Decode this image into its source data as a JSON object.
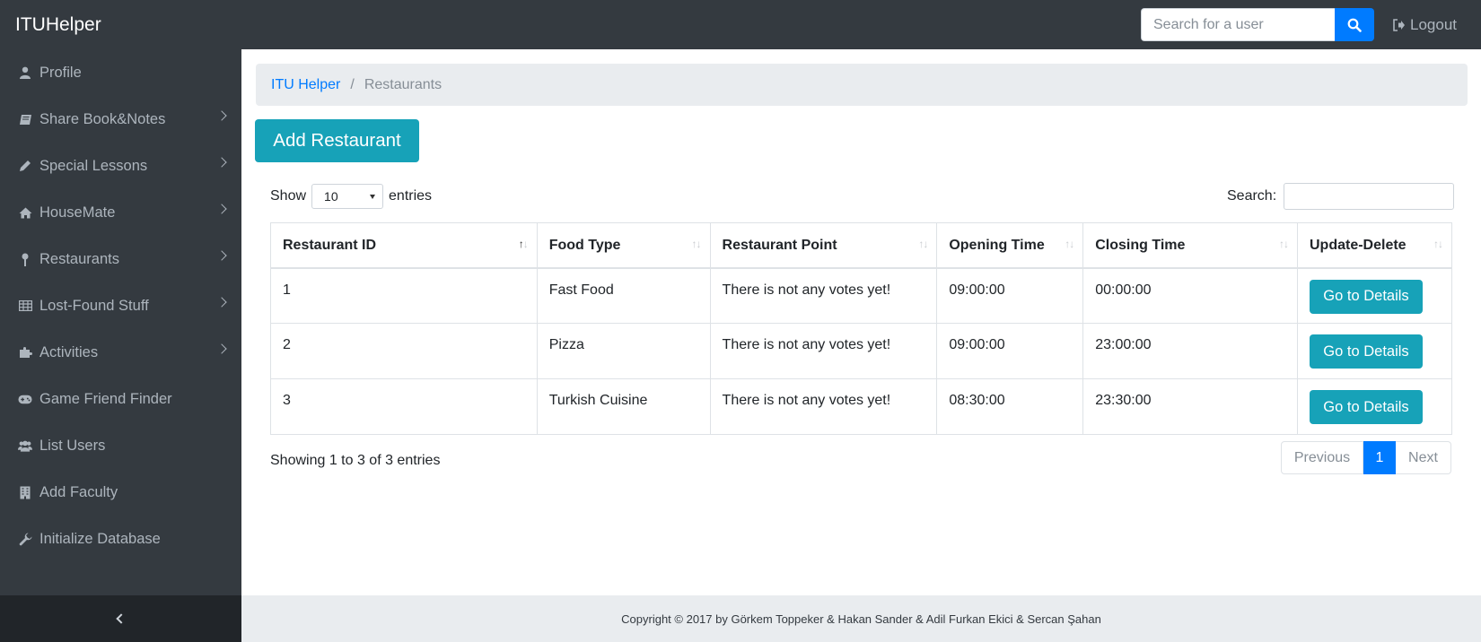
{
  "navbar": {
    "brand": "ITUHelper",
    "search_placeholder": "Search for a user",
    "logout_label": "Logout"
  },
  "sidebar": {
    "items": [
      {
        "label": "Profile",
        "icon": "user-icon",
        "has_submenu": false
      },
      {
        "label": "Share Book&Notes",
        "icon": "book-icon",
        "has_submenu": true
      },
      {
        "label": "Special Lessons",
        "icon": "pencil-icon",
        "has_submenu": true
      },
      {
        "label": "HouseMate",
        "icon": "home-icon",
        "has_submenu": true
      },
      {
        "label": "Restaurants",
        "icon": "pin-icon",
        "has_submenu": true
      },
      {
        "label": "Lost-Found Stuff",
        "icon": "table-icon",
        "has_submenu": true
      },
      {
        "label": "Activities",
        "icon": "puzzle-icon",
        "has_submenu": true
      },
      {
        "label": "Game Friend Finder",
        "icon": "gamepad-icon",
        "has_submenu": false
      },
      {
        "label": "List Users",
        "icon": "users-icon",
        "has_submenu": false
      },
      {
        "label": "Add Faculty",
        "icon": "building-icon",
        "has_submenu": false
      },
      {
        "label": "Initialize Database",
        "icon": "wrench-icon",
        "has_submenu": false
      }
    ]
  },
  "breadcrumb": {
    "home": "ITU Helper",
    "separator": "/",
    "current": "Restaurants"
  },
  "main": {
    "add_button_label": "Add Restaurant"
  },
  "datatable": {
    "show_label": "Show",
    "page_length": "10",
    "entries_label": "entries",
    "search_label": "Search:",
    "columns": [
      "Restaurant ID",
      "Food Type",
      "Restaurant Point",
      "Opening Time",
      "Closing Time",
      "Update-Delete"
    ],
    "rows": [
      {
        "id": "1",
        "food_type": "Fast Food",
        "point": "There is not any votes yet!",
        "opening": "09:00:00",
        "closing": "00:00:00",
        "action": "Go to Details"
      },
      {
        "id": "2",
        "food_type": "Pizza",
        "point": "There is not any votes yet!",
        "opening": "09:00:00",
        "closing": "23:00:00",
        "action": "Go to Details"
      },
      {
        "id": "3",
        "food_type": "Turkish Cuisine",
        "point": "There is not any votes yet!",
        "opening": "08:30:00",
        "closing": "23:30:00",
        "action": "Go to Details"
      }
    ],
    "info": "Showing 1 to 3 of 3 entries",
    "pagination": {
      "previous": "Previous",
      "current": "1",
      "next": "Next"
    }
  },
  "footer": {
    "text": "Copyright © 2017 by Görkem Toppeker & Hakan Sander & Adil Furkan Ekici & Sercan Şahan"
  },
  "colors": {
    "navbar_bg": "#343a40",
    "primary": "#007bff",
    "info_button": "#17a2b8",
    "light_bg": "#e9ecef"
  }
}
